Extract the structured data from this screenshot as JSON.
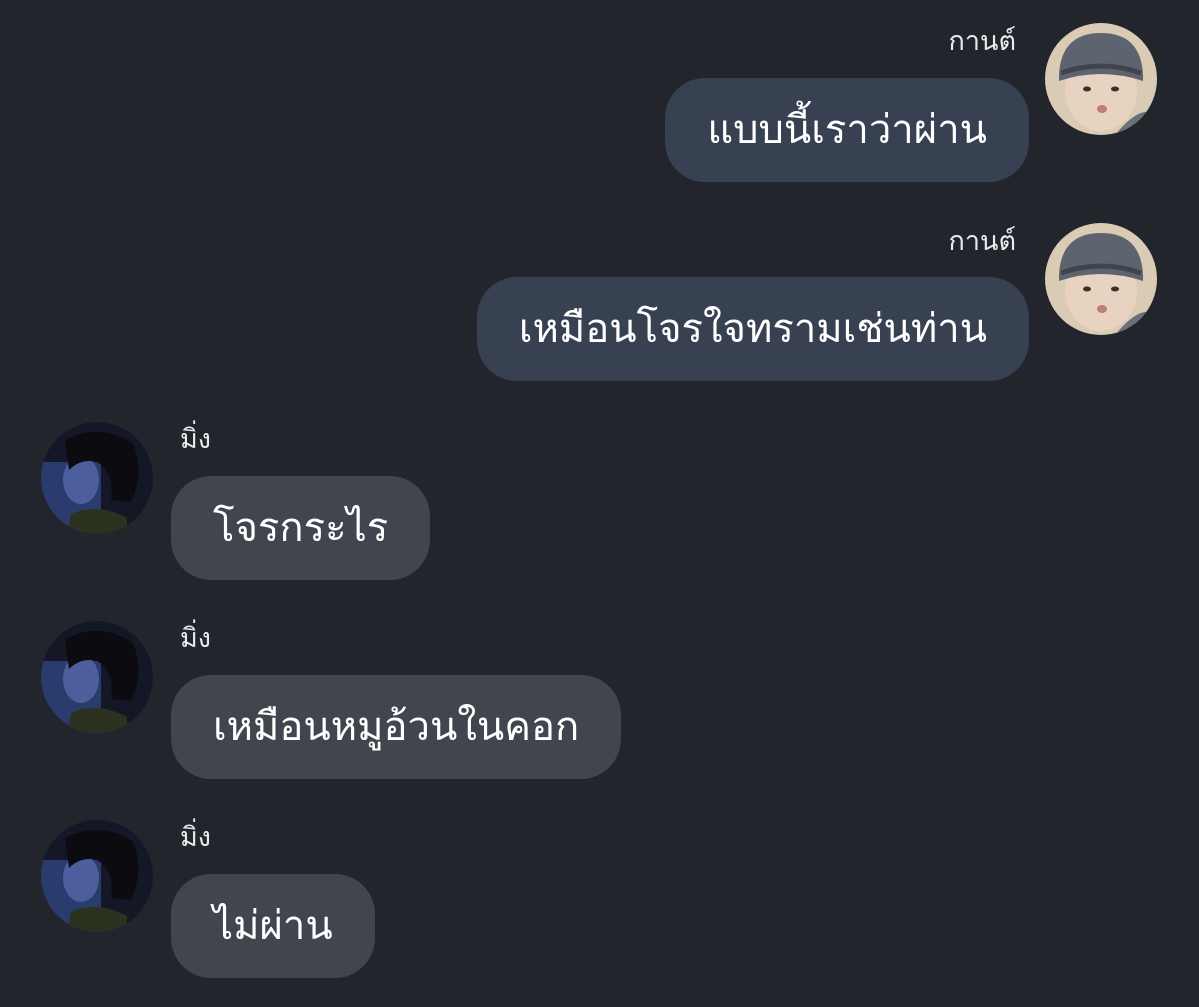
{
  "theme": {
    "background": "#22252c",
    "bubble_right": "#384152",
    "bubble_left": "#41454e",
    "text": "#ffffff"
  },
  "messages": [
    {
      "side": "right",
      "sender": "กานต์",
      "text": "แบบนี้เราว่าผ่าน",
      "avatar": "user-avatar-beanie"
    },
    {
      "side": "right",
      "sender": "กานต์",
      "text": "เหมือนโจรใจทรามเช่นท่าน",
      "avatar": "user-avatar-beanie"
    },
    {
      "side": "left",
      "sender": "มิ่ง",
      "text": "โจรกระไร",
      "avatar": "contact-avatar-dark"
    },
    {
      "side": "left",
      "sender": "มิ่ง",
      "text": "เหมือนหมูอ้วนในคอก",
      "avatar": "contact-avatar-dark"
    },
    {
      "side": "left",
      "sender": "มิ่ง",
      "text": "ไม่ผ่าน",
      "avatar": "contact-avatar-dark"
    }
  ]
}
